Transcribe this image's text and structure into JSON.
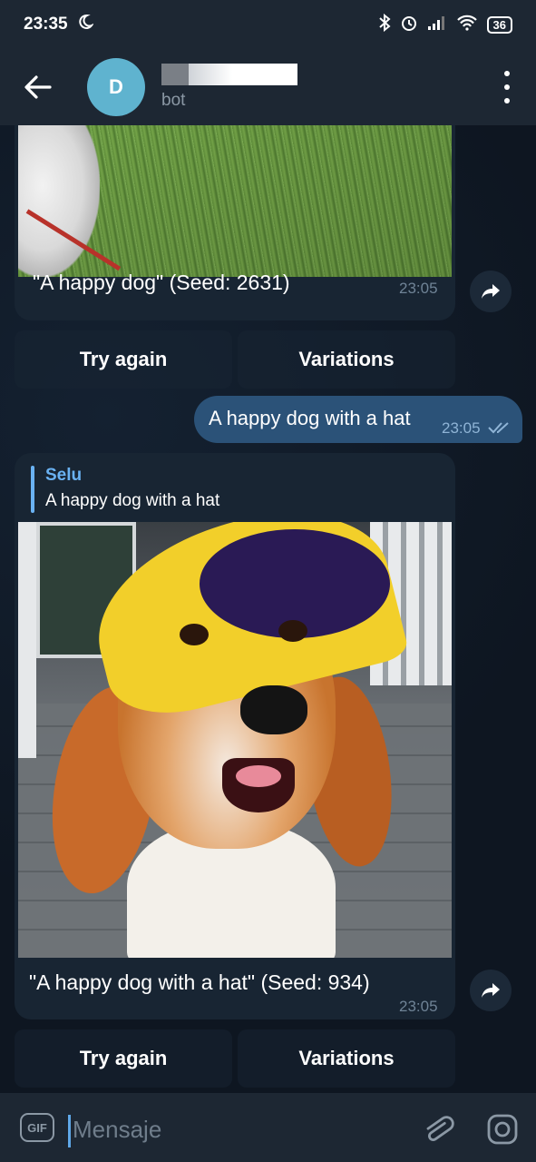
{
  "status_bar": {
    "time": "23:35",
    "battery": "36",
    "icons": [
      "moon-icon",
      "bluetooth-icon",
      "alarm-icon",
      "signal-icon",
      "wifi-icon",
      "battery-icon"
    ]
  },
  "header": {
    "avatar_letter": "D",
    "subtitle": "bot",
    "avatar_color": "#5fb3cf"
  },
  "messages": [
    {
      "type": "bot_photo",
      "caption": "\"A happy dog\" (Seed: 2631)",
      "time": "23:05",
      "buttons": [
        "Try again",
        "Variations"
      ]
    },
    {
      "type": "outgoing_text",
      "text": "A happy dog with a hat",
      "time": "23:05"
    },
    {
      "type": "bot_photo",
      "reply_author": "Selu",
      "reply_text": "A happy dog with a hat",
      "caption": "\"A happy dog with a hat\" (Seed: 934)",
      "time": "23:05",
      "buttons": [
        "Try again",
        "Variations"
      ]
    }
  ],
  "input": {
    "placeholder": "Mensaje",
    "gif_label": "GIF"
  },
  "colors": {
    "background": "#0e1621",
    "header": "#1d2733",
    "incoming_bubble": "#182533",
    "outgoing_bubble": "#2b5278",
    "accent": "#6ab2f2"
  }
}
